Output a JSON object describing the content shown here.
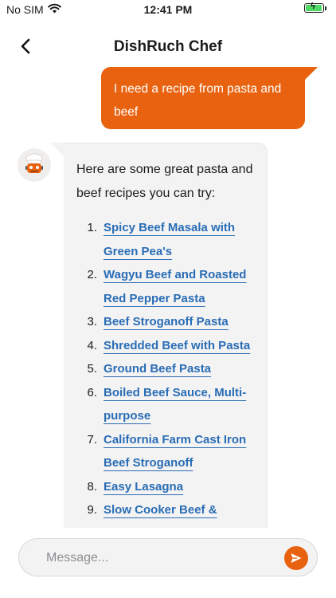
{
  "status_bar": {
    "carrier": "No SIM",
    "time": "12:41 PM",
    "icons": [
      "wifi-icon",
      "battery-charging-icon"
    ]
  },
  "header": {
    "title": "DishRuch Chef",
    "back_icon": "chevron-left-icon"
  },
  "chat": {
    "user_message": "I need a recipe from pasta and beef",
    "bot_avatar": "chef-robot-avatar",
    "bot_intro": "Here are some great pasta and beef recipes you can try:",
    "recipes": [
      {
        "num": "1.",
        "title": "Spicy Beef Masala with Green Pea's"
      },
      {
        "num": "2.",
        "title": "Wagyu Beef and Roasted Red Pepper Pasta"
      },
      {
        "num": "3.",
        "title": "Beef Stroganoff Pasta"
      },
      {
        "num": "4.",
        "title": "Shredded Beef with Pasta"
      },
      {
        "num": "5.",
        "title": "Ground Beef Pasta"
      },
      {
        "num": "6.",
        "title": "Boiled Beef Sauce, Multi-purpose"
      },
      {
        "num": "7.",
        "title": "California Farm Cast Iron Beef Stroganoff"
      },
      {
        "num": "8.",
        "title": "Easy Lasagna"
      },
      {
        "num": "9.",
        "title": "Slow Cooker Beef & Cheese Pasta"
      }
    ]
  },
  "composer": {
    "placeholder": "Message...",
    "send_icon": "send-icon"
  },
  "colors": {
    "accent": "#e8620f",
    "link": "#2a6db5",
    "bubble_bot": "#f3f3f4"
  }
}
